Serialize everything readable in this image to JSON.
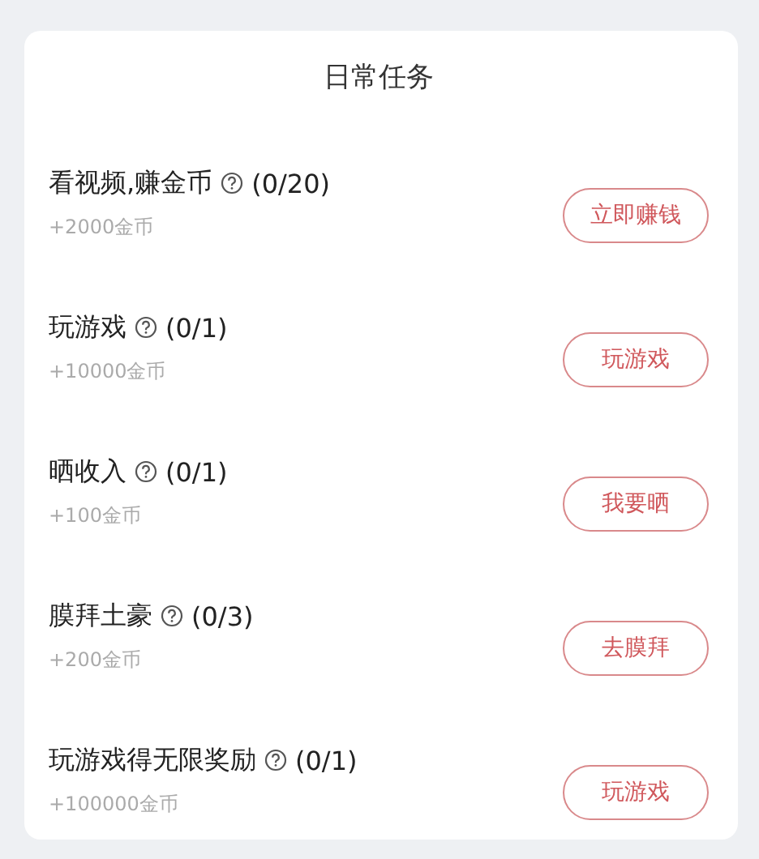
{
  "card": {
    "title": "日常任务"
  },
  "tasks": [
    {
      "name": "看视频,赚金币",
      "progress": "(0/20)",
      "reward": "+2000金币",
      "button": "立即赚钱"
    },
    {
      "name": "玩游戏",
      "progress": "(0/1)",
      "reward": "+10000金币",
      "button": "玩游戏"
    },
    {
      "name": "晒收入",
      "progress": "(0/1)",
      "reward": "+100金币",
      "button": "我要晒"
    },
    {
      "name": "膜拜土豪",
      "progress": "(0/3)",
      "reward": "+200金币",
      "button": "去膜拜"
    },
    {
      "name": "玩游戏得无限奖励",
      "progress": "(0/1)",
      "reward": "+100000金币",
      "button": "玩游戏"
    }
  ]
}
